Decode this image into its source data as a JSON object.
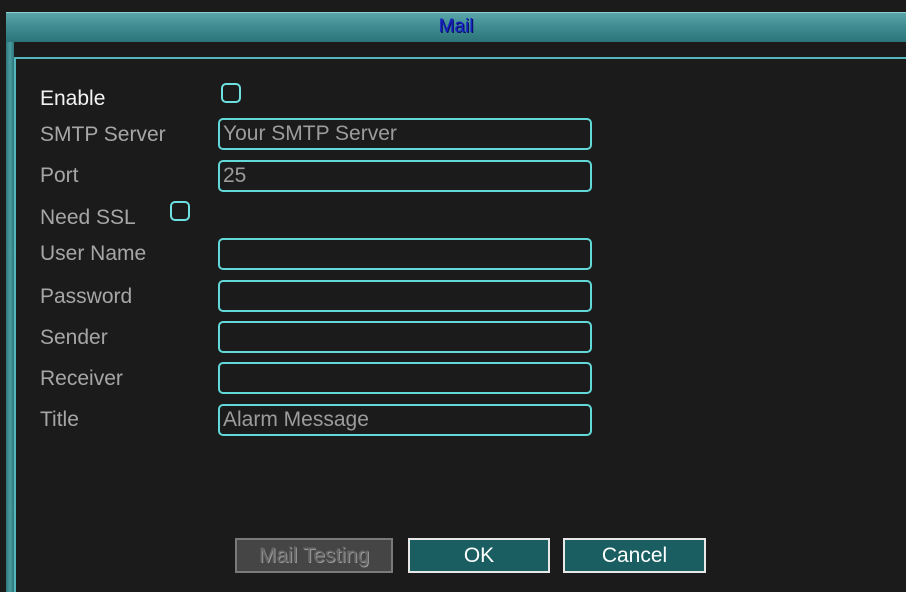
{
  "window": {
    "title": "Mail"
  },
  "form": {
    "enable": {
      "label": "Enable",
      "checked": false
    },
    "smtp_server": {
      "label": "SMTP Server",
      "value": "Your SMTP Server"
    },
    "port": {
      "label": "Port",
      "value": "25"
    },
    "need_ssl": {
      "label": "Need SSL",
      "checked": false
    },
    "user_name": {
      "label": "User Name",
      "value": ""
    },
    "password": {
      "label": "Password",
      "value": ""
    },
    "sender": {
      "label": "Sender",
      "value": ""
    },
    "receiver": {
      "label": "Receiver",
      "value": ""
    },
    "title": {
      "label": "Title",
      "value": "Alarm Message"
    }
  },
  "buttons": {
    "mail_testing": "Mail Testing",
    "ok": "OK",
    "cancel": "Cancel"
  },
  "colors": {
    "title_bar": "#3f8d92",
    "title_text": "#1622c4",
    "field_border": "#62d8d8",
    "button_bg": "#1a5e62"
  }
}
